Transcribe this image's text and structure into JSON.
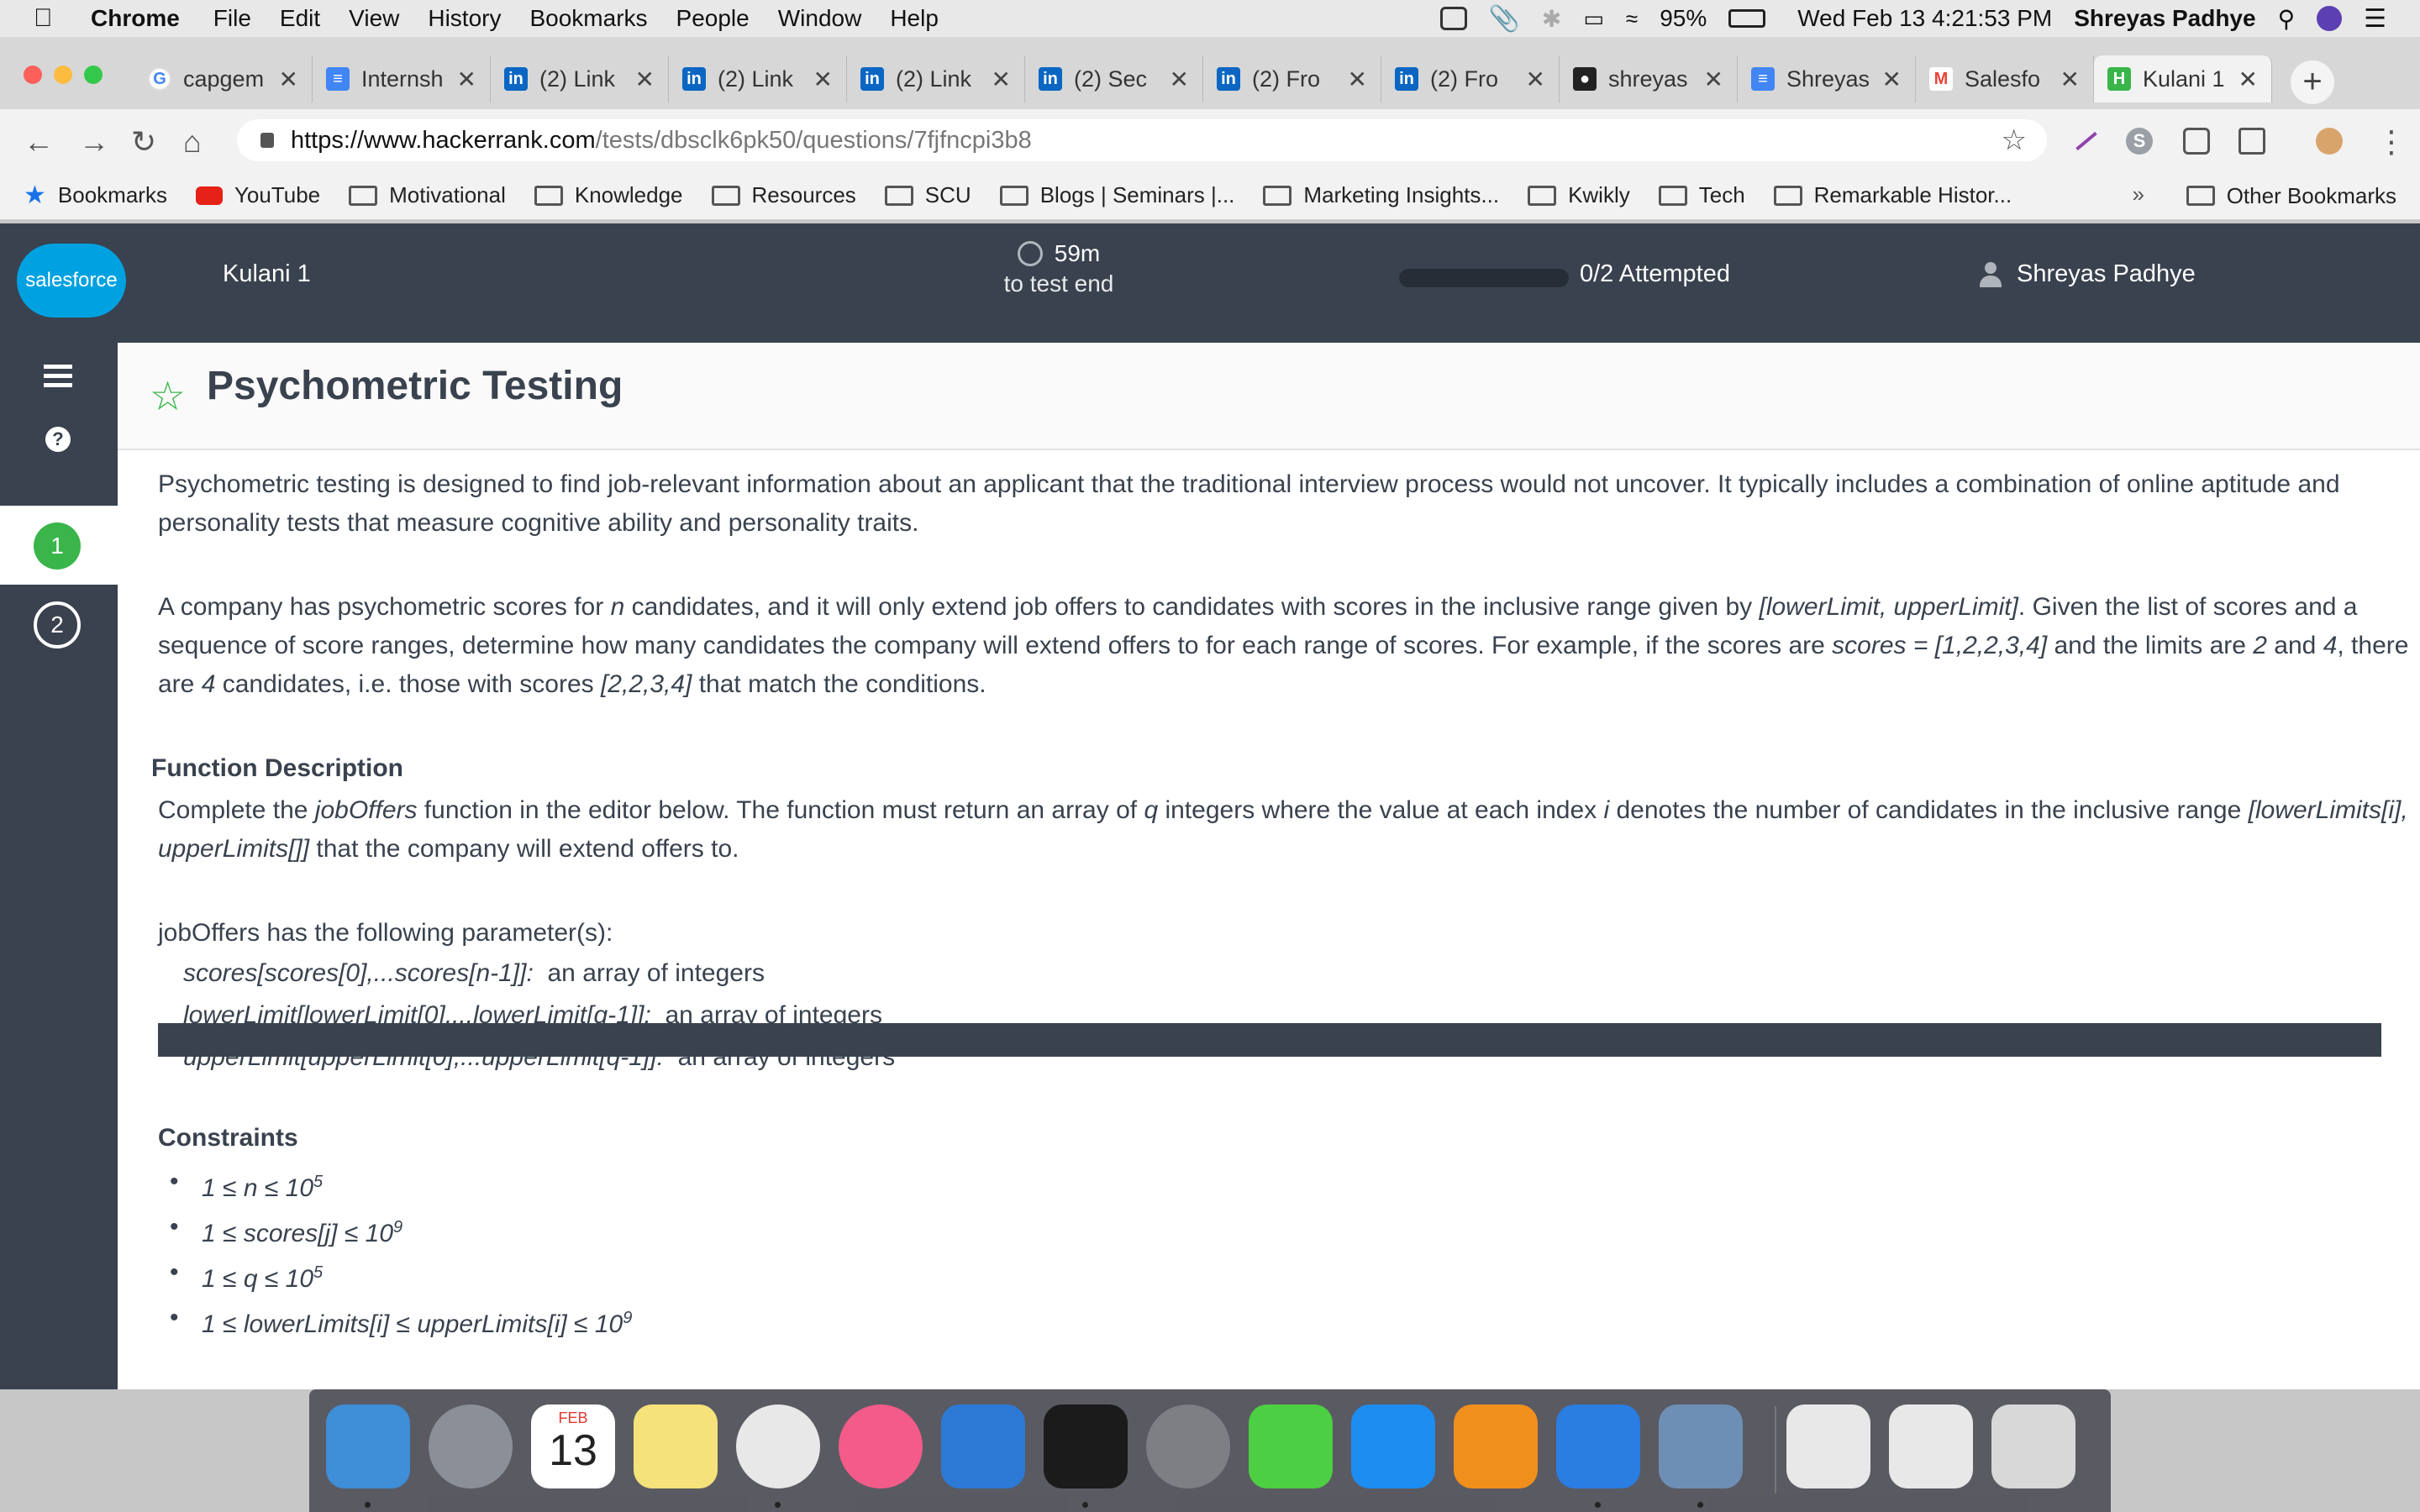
{
  "menubar": {
    "app": "Chrome",
    "items": [
      "File",
      "Edit",
      "View",
      "History",
      "Bookmarks",
      "People",
      "Window",
      "Help"
    ],
    "battery": "95%",
    "datetime": "Wed Feb 13  4:21:53 PM",
    "user": "Shreyas Padhye"
  },
  "tabs": [
    {
      "title": "capgem",
      "icon": "google-icon",
      "color": "#ffffff"
    },
    {
      "title": "Internsh",
      "icon": "docs-icon",
      "color": "#4285f4"
    },
    {
      "title": "(2) Link",
      "icon": "linkedin-icon",
      "color": "#0a66c2"
    },
    {
      "title": "(2) Link",
      "icon": "linkedin-icon",
      "color": "#0a66c2"
    },
    {
      "title": "(2) Link",
      "icon": "linkedin-icon",
      "color": "#0a66c2"
    },
    {
      "title": "(2) Sec",
      "icon": "linkedin-icon",
      "color": "#0a66c2"
    },
    {
      "title": "(2) Fro",
      "icon": "linkedin-icon",
      "color": "#0a66c2"
    },
    {
      "title": "(2) Fro",
      "icon": "linkedin-icon",
      "color": "#0a66c2"
    },
    {
      "title": "shreyas",
      "icon": "github-icon",
      "color": "#222222"
    },
    {
      "title": "Shreyas",
      "icon": "docs-icon",
      "color": "#4285f4"
    },
    {
      "title": "Salesfo",
      "icon": "gmail-icon",
      "color": "#ea4335"
    },
    {
      "title": "Kulani 1",
      "icon": "hackerrank-icon",
      "color": "#39b54a"
    }
  ],
  "url": {
    "host": "https://www.hackerrank.com",
    "path": "/tests/dbsclk6pk50/questions/7fjfncpi3b8"
  },
  "bookmarks": [
    {
      "label": "Bookmarks",
      "icon": "star-icon"
    },
    {
      "label": "YouTube",
      "icon": "youtube-icon"
    },
    {
      "label": "Motivational",
      "icon": "folder-icon"
    },
    {
      "label": "Knowledge",
      "icon": "folder-icon"
    },
    {
      "label": "Resources",
      "icon": "folder-icon"
    },
    {
      "label": "SCU",
      "icon": "folder-icon"
    },
    {
      "label": "Blogs | Seminars |...",
      "icon": "folder-icon"
    },
    {
      "label": "Marketing Insights...",
      "icon": "folder-icon"
    },
    {
      "label": "Kwikly",
      "icon": "folder-icon"
    },
    {
      "label": "Tech",
      "icon": "folder-icon"
    },
    {
      "label": "Remarkable Histor...",
      "icon": "folder-icon"
    }
  ],
  "bookmarks_more": "»",
  "bookmarks_other": "Other Bookmarks",
  "header": {
    "logo_text": "salesforce",
    "test_name": "Kulani 1",
    "time_left": "59m",
    "time_caption": "to test end",
    "attempted": "0/2 Attempted",
    "progress_fraction": 0,
    "user": "Shreyas Padhye"
  },
  "rail": {
    "help": "?",
    "questions": [
      "1",
      "2"
    ]
  },
  "question": {
    "title": "Psychometric Testing",
    "intro": "Psychometric testing is designed to find job-relevant information about an applicant that the traditional interview process would not uncover. It typically includes a combination of online aptitude and personality tests that measure cognitive ability and personality traits.",
    "p2": {
      "a": "A company has psychometric scores for ",
      "n": "n",
      "b": " candidates, and it will only extend job offers to candidates with scores in the inclusive range given by ",
      "range": "[lowerLimit, upperLimit]",
      "c": ". Given the list of scores and a sequence of score ranges, determine how many candidates the company will extend offers to for each range of scores. For example, if the scores are ",
      "scores": "scores = [1,2,2,3,4]",
      "d": " and the limits are ",
      "two": "2",
      "e": " and ",
      "four": "4",
      "f": ", there are ",
      "four2": "4",
      "g": " candidates, i.e. those with scores ",
      "list": "[2,2,3,4]",
      "h": " that match the conditions."
    },
    "fd_heading": "Function Description",
    "fd": {
      "a": "Complete the ",
      "fn": "jobOffers",
      "b": " function in the editor below. The function must return an array of ",
      "q": "q",
      "c": " integers where the value at each index ",
      "i": "i",
      "d": " denotes the number of candidates in the inclusive range ",
      "range": "[lowerLimits[i], upperLimits[]]",
      "e": " that the company will extend offers to."
    },
    "params_intro": "jobOffers has the following parameter(s):",
    "params": [
      {
        "sig": "scores[scores[0],...scores[n-1]]:",
        "desc": "an array of integers"
      },
      {
        "sig": "lowerLimit[lowerLimit[0],...lowerLimit[q-1]]:",
        "desc": "an array of integers"
      },
      {
        "sig": "upperLimit[upperLimit[0],...upperLimit[q-1]]:",
        "desc": "an array of integers"
      }
    ],
    "constraints_heading": "Constraints",
    "constraints": [
      {
        "text": "1 ≤ n ≤ 10",
        "sup": "5"
      },
      {
        "text": "1 ≤ scores[j] ≤ 10",
        "sup": "9"
      },
      {
        "text": "1 ≤ q ≤ 10",
        "sup": "5"
      },
      {
        "text": "1 ≤ lowerLimits[i] ≤ upperLimits[i] ≤ 10",
        "sup": "9"
      }
    ]
  },
  "dock": {
    "apps": [
      "finder-icon",
      "launchpad-icon",
      "calendar-icon",
      "notes-icon",
      "chrome-icon",
      "itunes-icon",
      "vscode-icon",
      "terminal-icon",
      "system-preferences-icon",
      "infuse-icon",
      "app-store-icon",
      "vlc-icon",
      "bluetooth-icon",
      "preview-icon",
      "documents-icon",
      "downloads-icon",
      "trash-icon"
    ],
    "calendar_month": "FEB",
    "calendar_day": "13"
  }
}
